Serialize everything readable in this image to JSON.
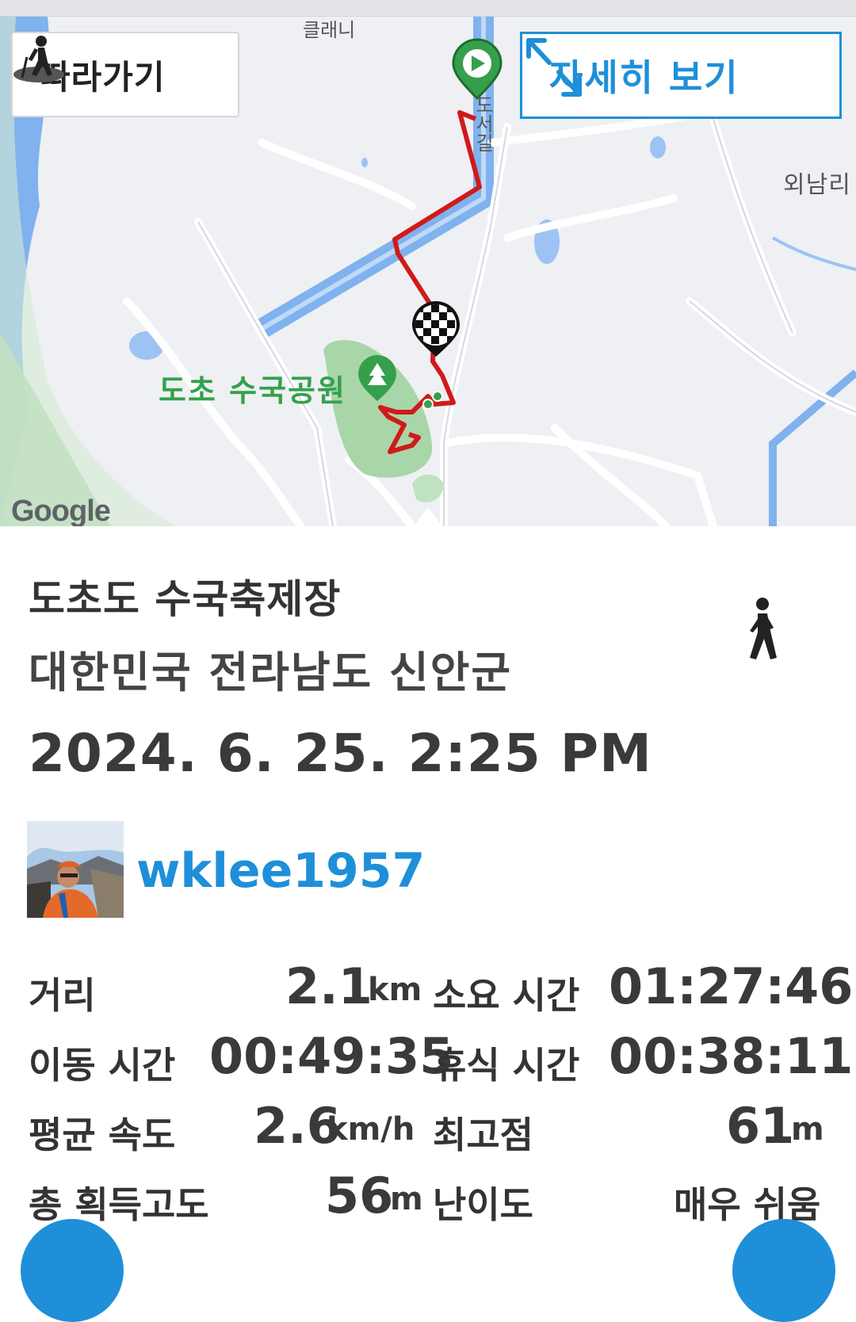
{
  "map": {
    "follow_button": {
      "label": "따라가기",
      "icon": "hiker-icon"
    },
    "detail_button": {
      "label": "자세히 보기",
      "icon": "expand-arrows-icon"
    },
    "labels": {
      "park": "도초 수국공원",
      "town": "외남리",
      "road_top": "클래니",
      "road_vertical": "도서길"
    },
    "attribution": "Google",
    "markers": [
      "start-flag-icon",
      "finish-checkered-icon",
      "park-tree-icon"
    ],
    "colors": {
      "route": "#d11a1a",
      "accent": "#1e8fd8",
      "park_green": "#35a04c"
    }
  },
  "track": {
    "place": "도초도 수국축제장",
    "region": "대한민국 전라남도 신안군",
    "datetime": "2024. 6. 25. 2:25 PM",
    "activity_icon": "walking-person-icon",
    "user": {
      "name": "wklee1957",
      "avatar": "avatar-photo"
    }
  },
  "stats": {
    "distance": {
      "label": "거리",
      "value": "2.1",
      "unit": "km"
    },
    "total_time": {
      "label": "소요 시간",
      "value": "01:27:46"
    },
    "moving_time": {
      "label": "이동 시간",
      "value": "00:49:35"
    },
    "rest_time": {
      "label": "휴식 시간",
      "value": "00:38:11"
    },
    "avg_speed": {
      "label": "평균 속도",
      "value": "2.6",
      "unit": "km/h"
    },
    "max_elev": {
      "label": "최고점",
      "value": "61",
      "unit": "m"
    },
    "total_gain": {
      "label": "총 획득고도",
      "value": "56",
      "unit": "m"
    },
    "difficulty": {
      "label": "난이도",
      "value": "매우 쉬움"
    }
  }
}
